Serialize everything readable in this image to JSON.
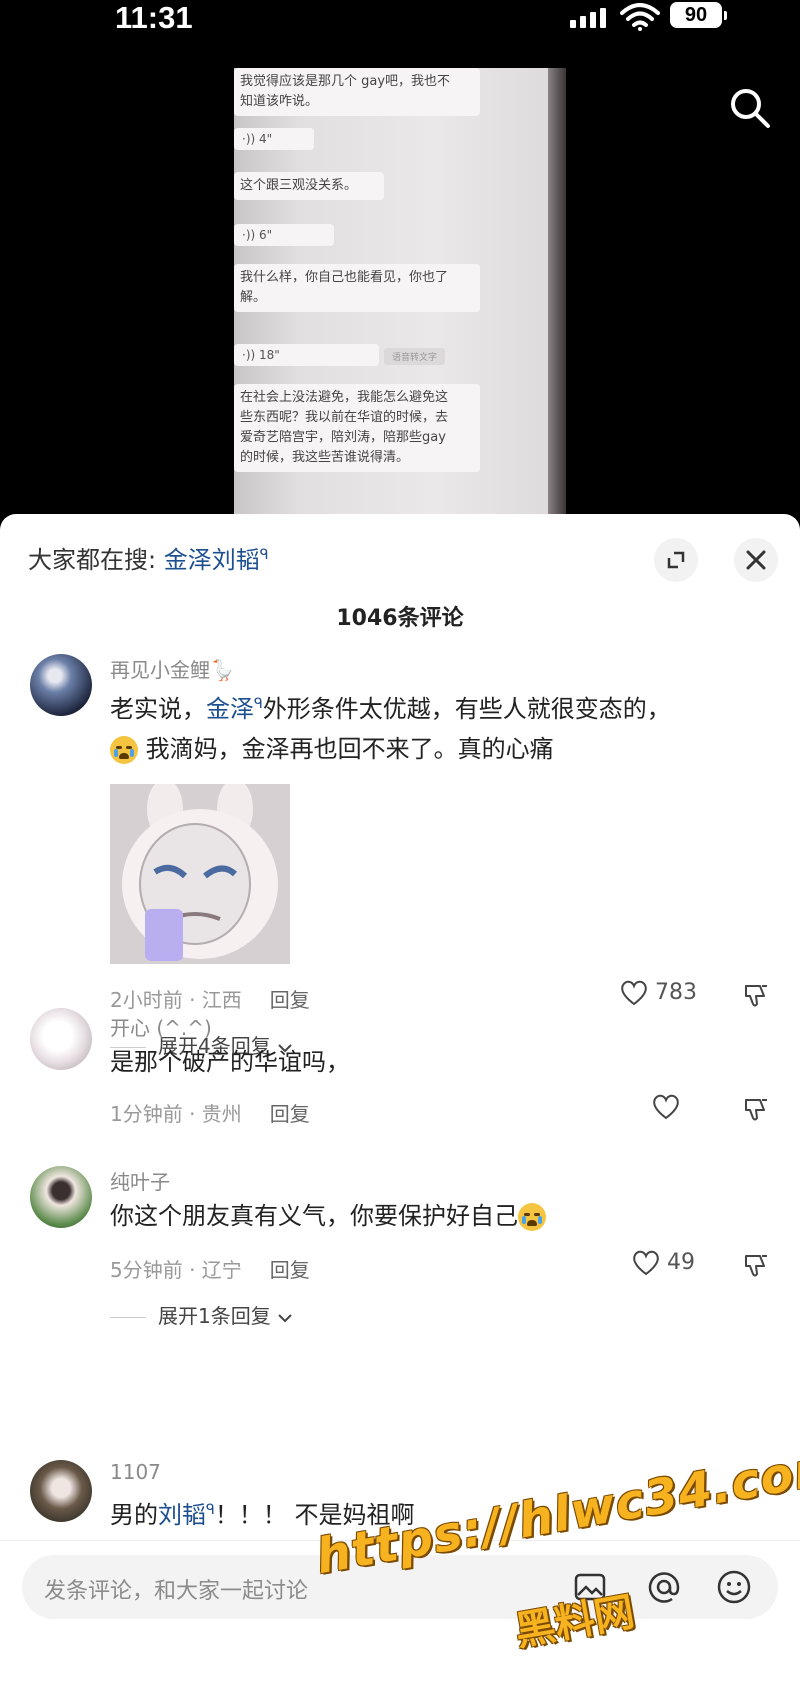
{
  "status_bar": {
    "time": "11:31",
    "battery": "90"
  },
  "video": {
    "chat_lines": [
      "我觉得应该是那几个 gay吧，我也不\n知道该咋说。",
      "这个跟三观没关系。",
      "我什么样，你自己也能看见，你也了\n解。",
      "在社会上没法避免，我能怎么避免这\n些东西呢？我以前在华谊的时候，去\n爱奇艺陪宫宇，陪刘涛，陪那些gay\n的时候，我这些苦谁说得清。"
    ],
    "voice_durations": [
      "4\"",
      "6\"",
      "18\""
    ],
    "stamp": "语音转文字"
  },
  "trending": {
    "prefix": "大家都在搜: ",
    "keyword": "金泽刘韬"
  },
  "comments_count": "1046条评论",
  "comments": [
    {
      "user": "再见小金鲤🪿",
      "text_a": "老实说，",
      "text_kw": "金泽",
      "text_b": "外形条件太优越，有些人就很变态的，",
      "text_c": "我滴妈，金泽再也回不来了。真的心痛",
      "time_loc": "2小时前 · 江西",
      "reply": "回复",
      "likes": "783",
      "expand": "展开4条回复"
    },
    {
      "user": "开心 (^.^)",
      "text": "是那个破产的华谊吗，",
      "time_loc": "1分钟前 · 贵州",
      "reply": "回复",
      "likes": ""
    },
    {
      "user": "纯叶子",
      "text": "你这个朋友真有义气，你要保护好自己",
      "time_loc": "5分钟前 · 辽宁",
      "reply": "回复",
      "likes": "49",
      "expand": "展开1条回复"
    },
    {
      "user": "1107",
      "text_a": "男的",
      "text_kw": "刘韬",
      "text_b": "！！！ 不是妈祖啊"
    }
  ],
  "input": {
    "placeholder": "发条评论，和大家一起讨论"
  },
  "watermark": {
    "url": "https://hlwc34.com",
    "site": "黑料网"
  },
  "icons": [
    "search-icon",
    "expand-icon",
    "close-icon",
    "heart-icon",
    "dislike-icon",
    "chevron-down-icon",
    "image-icon",
    "at-icon",
    "emoji-icon"
  ]
}
